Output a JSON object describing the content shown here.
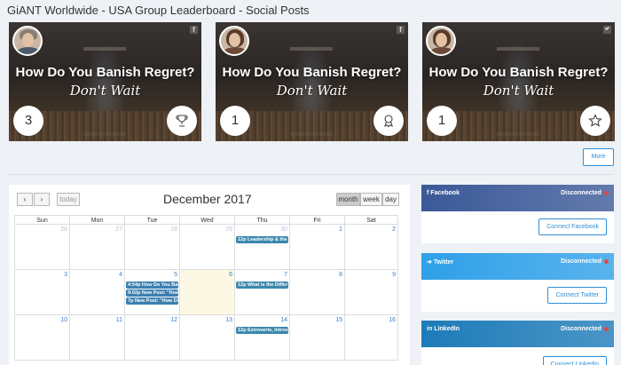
{
  "page": {
    "title": "GiANT Worldwide - USA Group Leaderboard - Social Posts"
  },
  "posts": [
    {
      "headline": "How Do You Banish Regret?",
      "tagline": "Don't Wait",
      "count": "3",
      "rank_icon": "trophy-icon",
      "network": "f",
      "avatar": "male"
    },
    {
      "headline": "How Do You Banish Regret?",
      "tagline": "Don't Wait",
      "count": "1",
      "rank_icon": "ribbon-medal-icon",
      "network": "f",
      "avatar": "female"
    },
    {
      "headline": "How Do You Banish Regret?",
      "tagline": "Don't Wait",
      "count": "1",
      "rank_icon": "star-icon",
      "network": "twitter",
      "avatar": "female"
    }
  ],
  "more_label": "More",
  "calendar": {
    "title": "December 2017",
    "today_label": "today",
    "views": [
      "month",
      "week",
      "day"
    ],
    "active_view": "month",
    "weekdays": [
      "Sun",
      "Mon",
      "Tue",
      "Wed",
      "Thu",
      "Fri",
      "Sat"
    ],
    "weeks": [
      [
        "26",
        "27",
        "28",
        "29",
        "30",
        "1",
        "2"
      ],
      [
        "3",
        "4",
        "5",
        "6",
        "7",
        "8",
        "9"
      ],
      [
        "10",
        "11",
        "12",
        "13",
        "14",
        "15",
        "16"
      ]
    ],
    "events": {
      "w0d4": [
        "12p Leadership & the P"
      ],
      "w1d2": [
        "4:54p How Do You Bani",
        "9:02p New Post: \"How",
        "7p New Post: \"How Do"
      ],
      "w1d4": [
        "12p What is the Differ"
      ],
      "w2d4": [
        "12p Extroverts, Introve"
      ]
    }
  },
  "social_accounts": [
    {
      "name": "Facebook",
      "status": "Disconnected",
      "button": "Connect Facebook",
      "color": "#3b5998",
      "icon": "facebook-icon"
    },
    {
      "name": "Twitter",
      "status": "Disconnected",
      "button": "Connect Twitter",
      "color": "#2fa0e8",
      "icon": "twitter-icon"
    },
    {
      "name": "LinkedIn",
      "status": "Disconnected",
      "button": "Connect LinkedIn",
      "color": "#1d7bb8",
      "icon": "linkedin-icon"
    }
  ]
}
